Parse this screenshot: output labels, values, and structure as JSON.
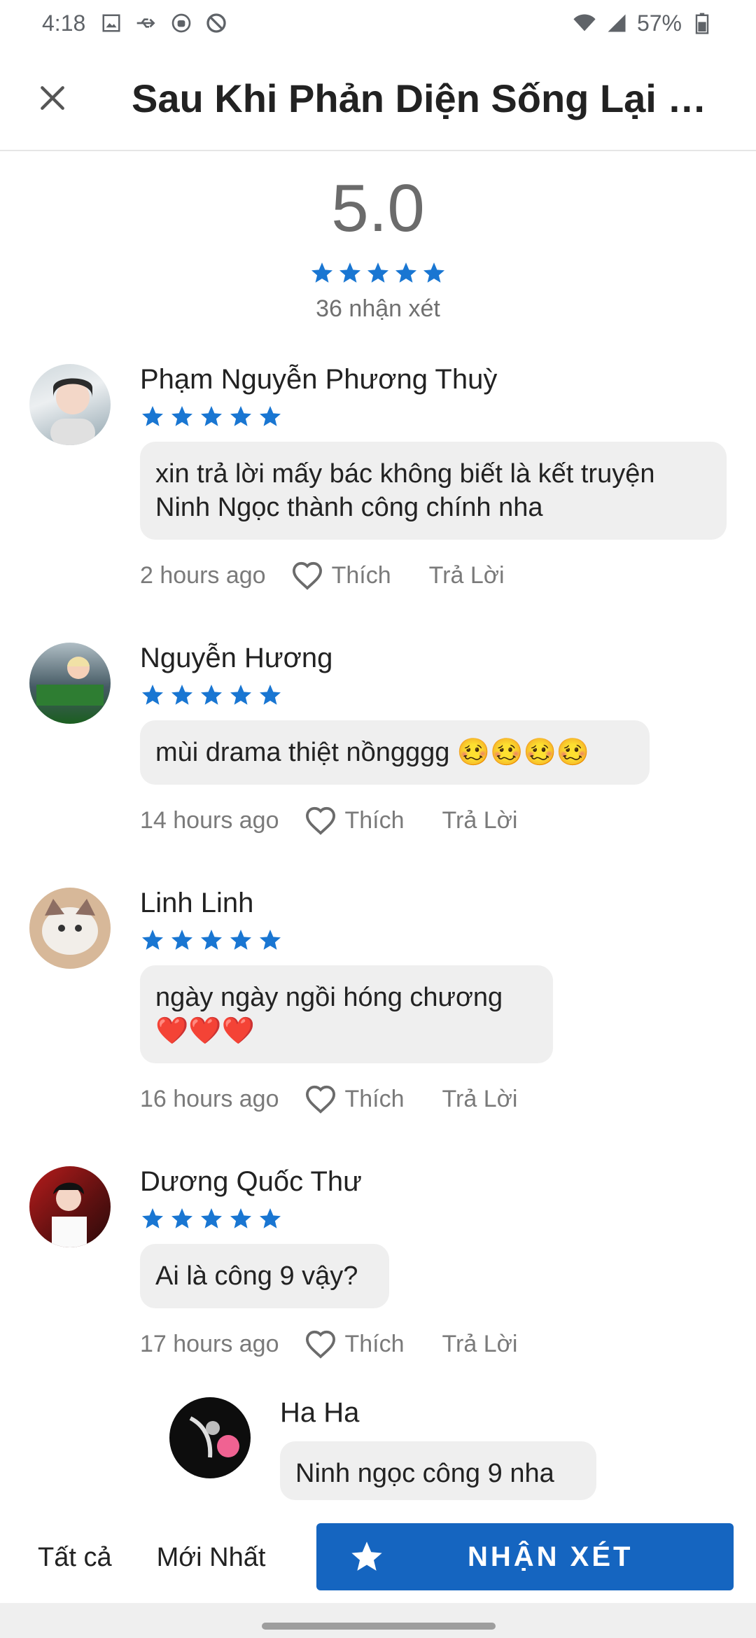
{
  "status_bar": {
    "time": "4:18",
    "battery": "57%",
    "icons": [
      "image-icon",
      "usb-icon",
      "android-icon",
      "no-sync-icon",
      "wifi-icon",
      "signal-icon",
      "battery-icon"
    ]
  },
  "header": {
    "title": "Sau Khi Phản Diện Sống Lại Đề…",
    "close_icon": "close-icon"
  },
  "summary": {
    "score": "5.0",
    "stars": 5,
    "count_label": "36 nhận xét"
  },
  "comments": [
    {
      "name": "Phạm Nguyễn Phương Thuỳ",
      "stars": 5,
      "text_line1": "xin trả lời mấy bác không biết là kết truyện",
      "text_line2": "Ninh Ngọc thành công chính nha",
      "time": "2 hours ago",
      "like": "Thích",
      "reply": "Trả Lời"
    },
    {
      "name": "Nguyễn Hương",
      "stars": 5,
      "text_line1": "mùi drama thiệt nồngggg 🥴🥴🥴🥴",
      "time": "14 hours ago",
      "like": "Thích",
      "reply": "Trả Lời"
    },
    {
      "name": "Linh Linh",
      "stars": 5,
      "text_line1": "ngày ngày ngồi hóng chương",
      "text_line2": "❤️❤️❤️",
      "time": "16 hours ago",
      "like": "Thích",
      "reply": "Trả Lời"
    },
    {
      "name": "Dương Quốc Thư",
      "stars": 5,
      "text_line1": "Ai là công 9 vậy?",
      "time": "17 hours ago",
      "like": "Thích",
      "reply": "Trả Lời"
    }
  ],
  "reply": {
    "name": "Ha Ha",
    "text": "Ninh ngọc công 9 nha"
  },
  "bottom_bar": {
    "tab_all": "Tất cả",
    "tab_newest": "Mới Nhất",
    "review_button": "NHẬN XÉT"
  },
  "colors": {
    "accent": "#1565c0",
    "star": "#1976d2",
    "bubble": "#efefef"
  }
}
